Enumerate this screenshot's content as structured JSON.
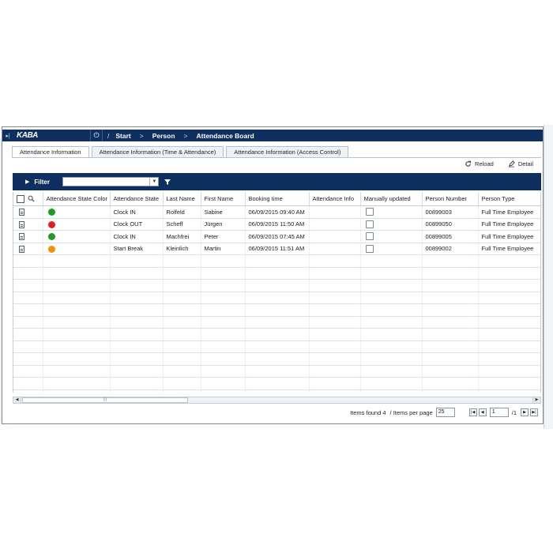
{
  "topbar": {
    "logo": "KABA",
    "breadcrumbs": [
      "Start",
      "Person",
      "Attendance Board"
    ]
  },
  "tabs": [
    {
      "label": "Attendance Information"
    },
    {
      "label": "Attendance Information (Time & Attendance)"
    },
    {
      "label": "Attendance Information (Access Control)"
    }
  ],
  "actions": {
    "reload": "Reload",
    "detail": "Detail"
  },
  "filter": {
    "label": "Filter",
    "value": ""
  },
  "grid": {
    "columns": [
      "Attendance State Color",
      "Attendance State",
      "Last Name",
      "First Name",
      "Booking time",
      "Attendance Info",
      "Manually updated",
      "Person Number",
      "Person Type"
    ],
    "rows": [
      {
        "color": "#1f9a22",
        "state": "Clock IN",
        "last": "Rolfeld",
        "first": "Sabine",
        "time": "06/09/2015 09:40 AM",
        "info": "",
        "manual": false,
        "number": "00899003",
        "type": "Full Time Employee"
      },
      {
        "color": "#e02020",
        "state": "Clock OUT",
        "last": "Scheff",
        "first": "Jürgen",
        "time": "06/09/2015 11:50 AM",
        "info": "",
        "manual": false,
        "number": "00899050",
        "type": "Full Time Employee"
      },
      {
        "color": "#1f9a22",
        "state": "Clock IN",
        "last": "Machfrei",
        "first": "Peter",
        "time": "06/09/2015 07:45 AM",
        "info": "",
        "manual": false,
        "number": "00899005",
        "type": "Full Time Employee"
      },
      {
        "color": "#f0920c",
        "state": "Start Break",
        "last": "Kleinlich",
        "first": "Martin",
        "time": "06/09/2015 11:51 AM",
        "info": "",
        "manual": false,
        "number": "00899002",
        "type": "Full Time Employee"
      }
    ]
  },
  "pager": {
    "items_found": "Items found 4",
    "items_per_page_label": "/ Items per page",
    "items_per_page": "25",
    "page": "1",
    "total": "/1"
  },
  "colors": {
    "nav": "#0f2f61",
    "green": "#1f9a22",
    "red": "#e02020",
    "orange": "#f0920c"
  }
}
